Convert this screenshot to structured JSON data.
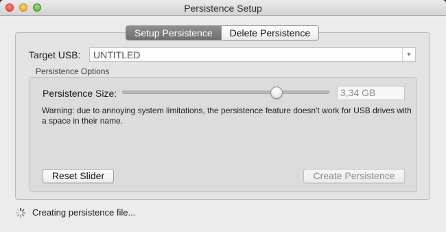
{
  "window": {
    "title": "Persistence Setup"
  },
  "tabs": [
    {
      "label": "Setup Persistence",
      "active": true
    },
    {
      "label": "Delete Persistence",
      "active": false
    }
  ],
  "target_usb": {
    "label": "Target USB:",
    "value": "UNTITLED"
  },
  "persistence_options": {
    "caption": "Persistence Options",
    "size_label": "Persistence Size:",
    "size_value": "3,34 GB",
    "slider_fraction": 0.76,
    "warning": "Warning: due to annoying system limitations, the persistence feature doesn't work for USB drives with a space in their name."
  },
  "buttons": {
    "reset": "Reset Slider",
    "create": "Create Persistence"
  },
  "status": {
    "text": "Creating persistence file..."
  },
  "icons": {
    "spinner": "spinner-icon",
    "dropdown": "chevron-down-icon"
  }
}
